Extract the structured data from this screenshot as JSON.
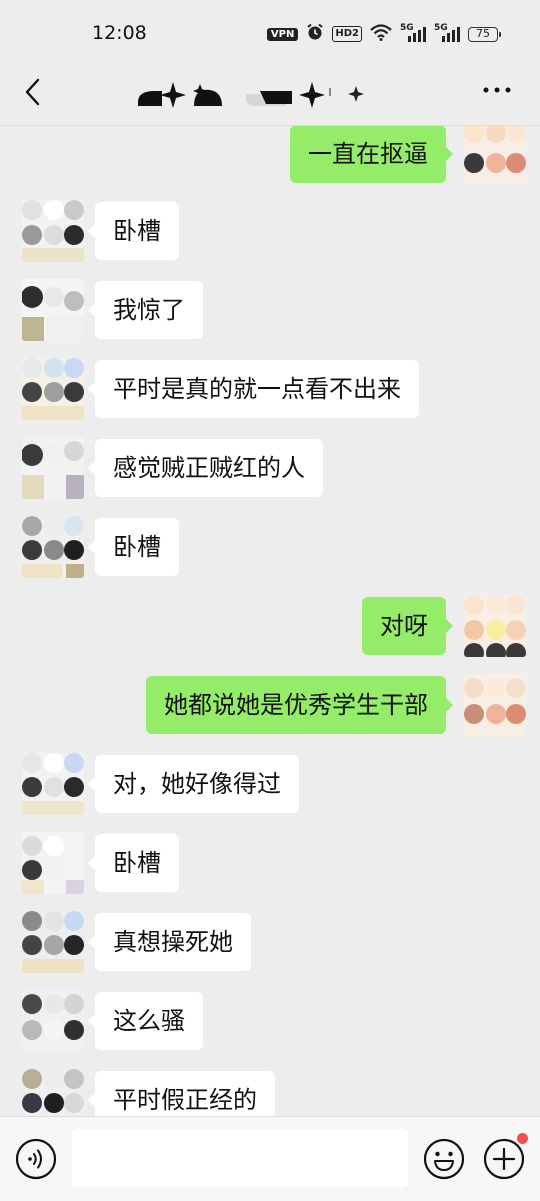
{
  "status": {
    "time": "12:08",
    "vpn_label": "VPN",
    "hd_label": "HD2",
    "signal_label_1": "5G",
    "signal_label_2": "5G",
    "battery": "75",
    "icons": [
      "alarm-icon",
      "wifi-icon",
      "signal-icon",
      "battery-icon"
    ]
  },
  "nav": {
    "back_icon": "chevron-left-icon",
    "more_icon": "more-dots-icon",
    "title_icon": "obscured-title-emoji"
  },
  "colors": {
    "background": "#ededed",
    "sent_bubble": "#95ec69",
    "received_bubble": "#ffffff",
    "badge_dot": "#f54c4c"
  },
  "messages": [
    {
      "side": "right",
      "text": "一直在抠逼"
    },
    {
      "side": "left",
      "text": "卧槽"
    },
    {
      "side": "left",
      "text": "我惊了"
    },
    {
      "side": "left",
      "text": "平时是真的就一点看不出来"
    },
    {
      "side": "left",
      "text": "感觉贼正贼红的人"
    },
    {
      "side": "left",
      "text": "卧槽"
    },
    {
      "side": "right",
      "text": "对呀"
    },
    {
      "side": "right",
      "text": "她都说她是优秀学生干部"
    },
    {
      "side": "left",
      "text": "对，她好像得过"
    },
    {
      "side": "left",
      "text": "卧槽"
    },
    {
      "side": "left",
      "text": "真想操死她"
    },
    {
      "side": "left",
      "text": "这么骚"
    },
    {
      "side": "left",
      "text": "平时假正经的"
    }
  ],
  "input": {
    "voice_icon": "voice-icon",
    "emoji_icon": "emoji-icon",
    "plus_icon": "plus-icon",
    "placeholder": ""
  }
}
